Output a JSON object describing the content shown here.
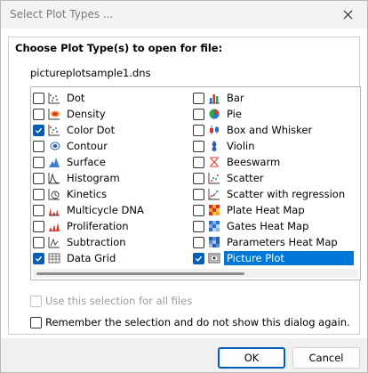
{
  "window": {
    "title": "Select Plot Types ..."
  },
  "group": {
    "label": "Choose Plot Type(s) to open for file:",
    "file": "pictureplotsample1.dns"
  },
  "plots_left": [
    {
      "label": "Dot",
      "checked": false,
      "icon": "dot-plot-icon"
    },
    {
      "label": "Density",
      "checked": false,
      "icon": "density-plot-icon"
    },
    {
      "label": "Color Dot",
      "checked": true,
      "icon": "color-dot-plot-icon"
    },
    {
      "label": "Contour",
      "checked": false,
      "icon": "contour-plot-icon"
    },
    {
      "label": "Surface",
      "checked": false,
      "icon": "surface-plot-icon"
    },
    {
      "label": "Histogram",
      "checked": false,
      "icon": "histogram-plot-icon"
    },
    {
      "label": "Kinetics",
      "checked": false,
      "icon": "kinetics-plot-icon"
    },
    {
      "label": "Multicycle DNA",
      "checked": false,
      "icon": "multicycle-dna-plot-icon"
    },
    {
      "label": "Proliferation",
      "checked": false,
      "icon": "proliferation-plot-icon"
    },
    {
      "label": "Subtraction",
      "checked": false,
      "icon": "subtraction-plot-icon"
    },
    {
      "label": "Data Grid",
      "checked": true,
      "icon": "data-grid-icon"
    }
  ],
  "plots_right": [
    {
      "label": "Bar",
      "checked": false,
      "icon": "bar-plot-icon"
    },
    {
      "label": "Pie",
      "checked": false,
      "icon": "pie-plot-icon"
    },
    {
      "label": "Box and Whisker",
      "checked": false,
      "icon": "box-whisker-plot-icon"
    },
    {
      "label": "Violin",
      "checked": false,
      "icon": "violin-plot-icon"
    },
    {
      "label": "Beeswarm",
      "checked": false,
      "icon": "beeswarm-plot-icon"
    },
    {
      "label": "Scatter",
      "checked": false,
      "icon": "scatter-plot-icon"
    },
    {
      "label": "Scatter with regression",
      "checked": false,
      "icon": "scatter-regression-plot-icon"
    },
    {
      "label": "Plate Heat Map",
      "checked": false,
      "icon": "plate-heat-map-icon"
    },
    {
      "label": "Gates Heat Map",
      "checked": false,
      "icon": "gates-heat-map-icon"
    },
    {
      "label": "Parameters Heat Map",
      "checked": false,
      "icon": "parameters-heat-map-icon"
    },
    {
      "label": "Picture Plot",
      "checked": true,
      "selected": true,
      "icon": "picture-plot-icon"
    }
  ],
  "options": {
    "use_for_all": "Use this selection for all files",
    "remember": "Remember the selection and do not show this dialog again."
  },
  "buttons": {
    "ok": "OK",
    "cancel": "Cancel"
  },
  "colors": {
    "accent": "#005fb8",
    "selection": "#0078d7"
  }
}
